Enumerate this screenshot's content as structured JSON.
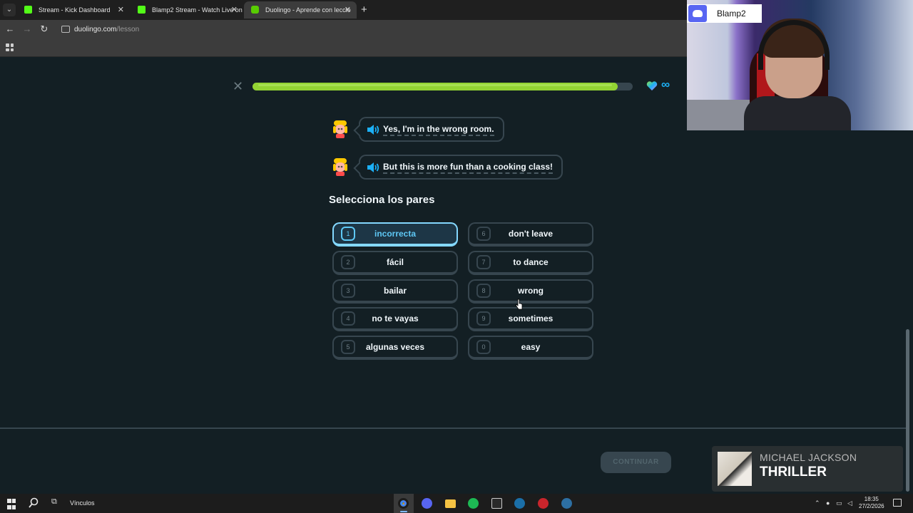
{
  "browser": {
    "tabs": [
      {
        "title": "Stream - Kick Dashboard"
      },
      {
        "title": "Blamp2 Stream - Watch Live on"
      },
      {
        "title": "Duolingo - Aprende con leccio"
      }
    ],
    "new_tab": "+",
    "url_domain": "duolingo.com",
    "url_path": "/lesson"
  },
  "lesson": {
    "progress": 0.96,
    "hearts": "∞",
    "dialog": [
      {
        "text": "Yes, I'm in the wrong room."
      },
      {
        "text": "But this is more fun than a cooking class!"
      }
    ],
    "prompt": "Selecciona los pares",
    "left_options": [
      {
        "num": "1",
        "label": "incorrecta",
        "state": "selected"
      },
      {
        "num": "2",
        "label": "fácil"
      },
      {
        "num": "3",
        "label": "bailar"
      },
      {
        "num": "4",
        "label": "no te vayas"
      },
      {
        "num": "5",
        "label": "algunas veces"
      }
    ],
    "right_options": [
      {
        "num": "6",
        "label": "don't leave"
      },
      {
        "num": "7",
        "label": "to dance"
      },
      {
        "num": "8",
        "label": "wrong"
      },
      {
        "num": "9",
        "label": "sometimes"
      },
      {
        "num": "0",
        "label": "easy"
      }
    ],
    "continue_label": "CONTINUAR",
    "colors": {
      "accent_green": "#93d333",
      "selected_blue": "#84d8ff",
      "background": "#131f24"
    }
  },
  "overlay": {
    "discord_name": "Blamp2",
    "now_playing_artist": "MICHAEL JACKSON",
    "now_playing_title": "THRILLER"
  },
  "taskbar": {
    "vinculos": "Vínculos",
    "time": "18:35",
    "date": "27/2/2026"
  }
}
